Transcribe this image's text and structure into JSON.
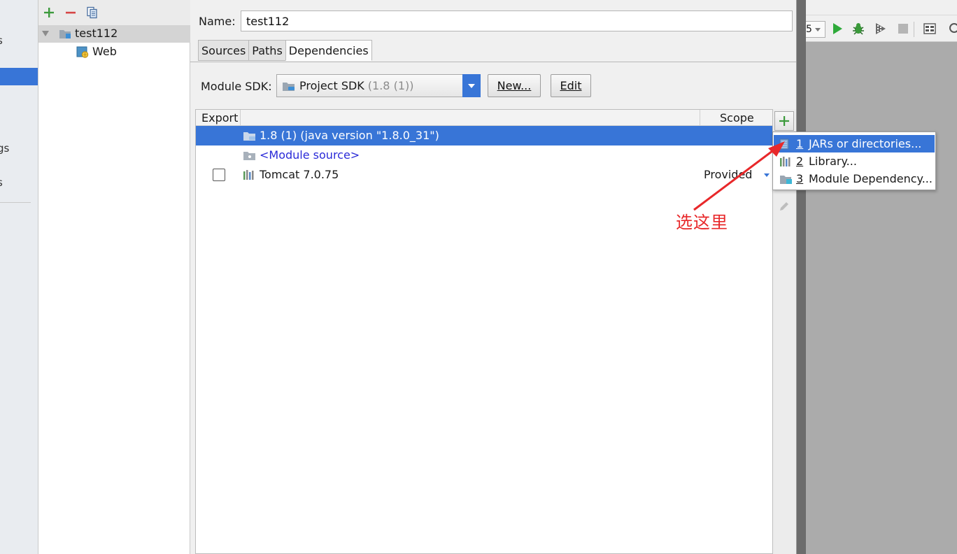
{
  "nav": {
    "fragments": [
      "s",
      "gs",
      "s"
    ]
  },
  "tree": {
    "module": "test112",
    "facet": "Web"
  },
  "details": {
    "name_label": "Name:",
    "name_value": "test112",
    "tabs": [
      "Sources",
      "Paths",
      "Dependencies"
    ],
    "active_tab": "Dependencies",
    "sdk_label": "Module SDK:",
    "sdk_value": "Project SDK",
    "sdk_version": "(1.8 (1))",
    "new_button": "New...",
    "edit_button": "Edit"
  },
  "table": {
    "header_export": "Export",
    "header_scope": "Scope",
    "rows": [
      {
        "text": "1.8 (1) (java version \"1.8.0_31\")",
        "selected": true
      },
      {
        "text": "<Module source>"
      },
      {
        "text": "Tomcat 7.0.75",
        "checked": false,
        "scope": "Provided"
      }
    ]
  },
  "popup": {
    "items": [
      {
        "num": "1",
        "label": "JARs or directories..."
      },
      {
        "num": "2",
        "label": "Library..."
      },
      {
        "num": "3",
        "label": "Module Dependency..."
      }
    ]
  },
  "ide": {
    "combo_fragment": "5"
  },
  "annotation": {
    "text": "选这里",
    "color": "#e8282a"
  },
  "colors": {
    "accent": "#3875d7",
    "add_green": "#3c9a3c",
    "remove_red": "#d64545"
  }
}
